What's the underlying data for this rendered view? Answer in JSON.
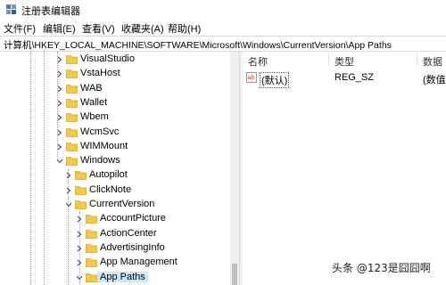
{
  "window": {
    "title": "注册表编辑器"
  },
  "menu": [
    "文件(F)",
    "编辑(E)",
    "查看(V)",
    "收藏夹(A)",
    "帮助(H)"
  ],
  "address": {
    "path": "计算机\\HKEY_LOCAL_MACHINE\\SOFTWARE\\Microsoft\\Windows\\CurrentVersion\\App Paths"
  },
  "tree": {
    "items": [
      {
        "label": "VisualStudio",
        "expanded": false
      },
      {
        "label": "VstaHost",
        "expanded": false
      },
      {
        "label": "WAB",
        "expanded": false
      },
      {
        "label": "Wallet",
        "expanded": false
      },
      {
        "label": "Wbem",
        "expanded": false
      },
      {
        "label": "WcmSvc",
        "expanded": false
      },
      {
        "label": "WIMMount",
        "expanded": false
      },
      {
        "label": "Windows",
        "expanded": true
      },
      {
        "label": "Autopilot",
        "expanded": false
      },
      {
        "label": "ClickNote",
        "expanded": false
      },
      {
        "label": "CurrentVersion",
        "expanded": true
      },
      {
        "label": "AccountPicture",
        "expanded": false
      },
      {
        "label": "ActionCenter",
        "expanded": false
      },
      {
        "label": "AdvertisingInfo",
        "expanded": false
      },
      {
        "label": "App Management",
        "expanded": false
      },
      {
        "label": "App Paths",
        "expanded": true,
        "selected": true
      }
    ]
  },
  "list": {
    "columns": [
      "名称",
      "类型",
      "数据"
    ],
    "rows": [
      {
        "name": "(默认)",
        "type": "REG_SZ",
        "data": "(数值未"
      }
    ]
  },
  "watermark": "头条 @123是囧囧啊",
  "colors": {
    "folder": "#f2c94c",
    "selection": "#cce8ff",
    "ab_icon": "#c0392b"
  }
}
